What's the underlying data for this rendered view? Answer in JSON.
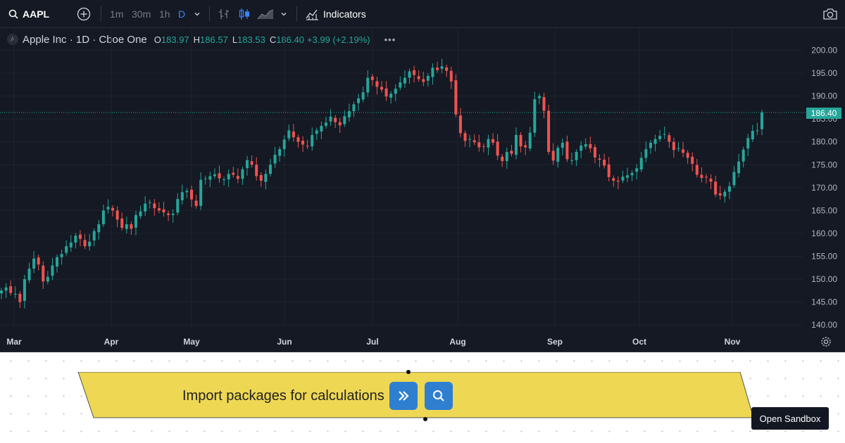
{
  "toolbar": {
    "symbol": "AAPL",
    "timeframes": [
      "1m",
      "30m",
      "1h",
      "D"
    ],
    "active_timeframe": "D",
    "indicators_label": "Indicators"
  },
  "legend": {
    "badge": "A",
    "title": "Apple Inc · 1D · Cboe One",
    "o_label": "O",
    "o_value": "183.97",
    "h_label": "H",
    "h_value": "186.57",
    "l_label": "L",
    "l_value": "183.53",
    "c_label": "C",
    "c_value": "186.40",
    "change": "+3.99 (+2.19%)"
  },
  "last_price_label": "186.40",
  "colors": {
    "up": "#26a69a",
    "down": "#ef5350",
    "background": "#141923",
    "accent": "#2f7fd1",
    "banner": "#eed753"
  },
  "chart_data": {
    "type": "candlestick",
    "y_axis_ticks": [
      "200.00",
      "195.00",
      "190.00",
      "185.00",
      "180.00",
      "175.00",
      "170.00",
      "165.00",
      "160.00",
      "155.00",
      "150.00",
      "145.00",
      "140.00"
    ],
    "ylim": [
      140,
      200
    ],
    "x_axis_labels": [
      "Mar",
      "Apr",
      "May",
      "Jun",
      "Jul",
      "Aug",
      "Sep",
      "Oct",
      "Nov"
    ],
    "last_close": 186.4,
    "closes": [
      147.5,
      148.2,
      147,
      146.8,
      145,
      150,
      152.3,
      154.5,
      153.2,
      149.5,
      150.5,
      153,
      154.8,
      155.5,
      157.2,
      158,
      159.5,
      158.8,
      157.2,
      158.2,
      160.5,
      162,
      165,
      165.8,
      165,
      163,
      161.2,
      162,
      161,
      164,
      164.8,
      166.5,
      166.8,
      165.5,
      165,
      164.6,
      164,
      164.3,
      167.5,
      169,
      169.3,
      167.4,
      166,
      171.7,
      172,
      172.5,
      172.9,
      172,
      171.8,
      173,
      172.8,
      171.9,
      174,
      176,
      175,
      172.5,
      171.5,
      173,
      175,
      177.2,
      178.4,
      180.5,
      182.5,
      181,
      180,
      179.4,
      179,
      181.5,
      182.5,
      183.5,
      184.2,
      185.5,
      184.3,
      183.6,
      185.6,
      186.7,
      188.2,
      189.5,
      190.8,
      194,
      193.5,
      192,
      191.4,
      189.9,
      190.5,
      191.6,
      193,
      194,
      195.4,
      194.6,
      193.7,
      193.1,
      194.4,
      196.2,
      195.7,
      196.5,
      195.5,
      193.2,
      186,
      181.9,
      180.2,
      180.6,
      179.9,
      178.8,
      179,
      180.6,
      179.8,
      177,
      175.8,
      177.8,
      177.4,
      181.5,
      179,
      178.8,
      182,
      189.3,
      190,
      186.8,
      177.8,
      175.9,
      178.7,
      179.8,
      176.2,
      176,
      177.8,
      179.2,
      179.5,
      178.6,
      176.6,
      176.1,
      174.8,
      172.3,
      171.5,
      171.3,
      172.4,
      172.7,
      173.2,
      174.2,
      176.5,
      178.4,
      179.8,
      180.6,
      181.3,
      181.7,
      180,
      178.2,
      178.6,
      177.6,
      176.5,
      175.2,
      172.8,
      172.1,
      172.2,
      171.3,
      168.5,
      168.3,
      169.1,
      170.3,
      173.4,
      175.7,
      178.3,
      180.8,
      182.4,
      182.5,
      186.4
    ]
  },
  "banner": {
    "text": "Import packages for calculations"
  },
  "open_sandbox_label": "Open Sandbox"
}
